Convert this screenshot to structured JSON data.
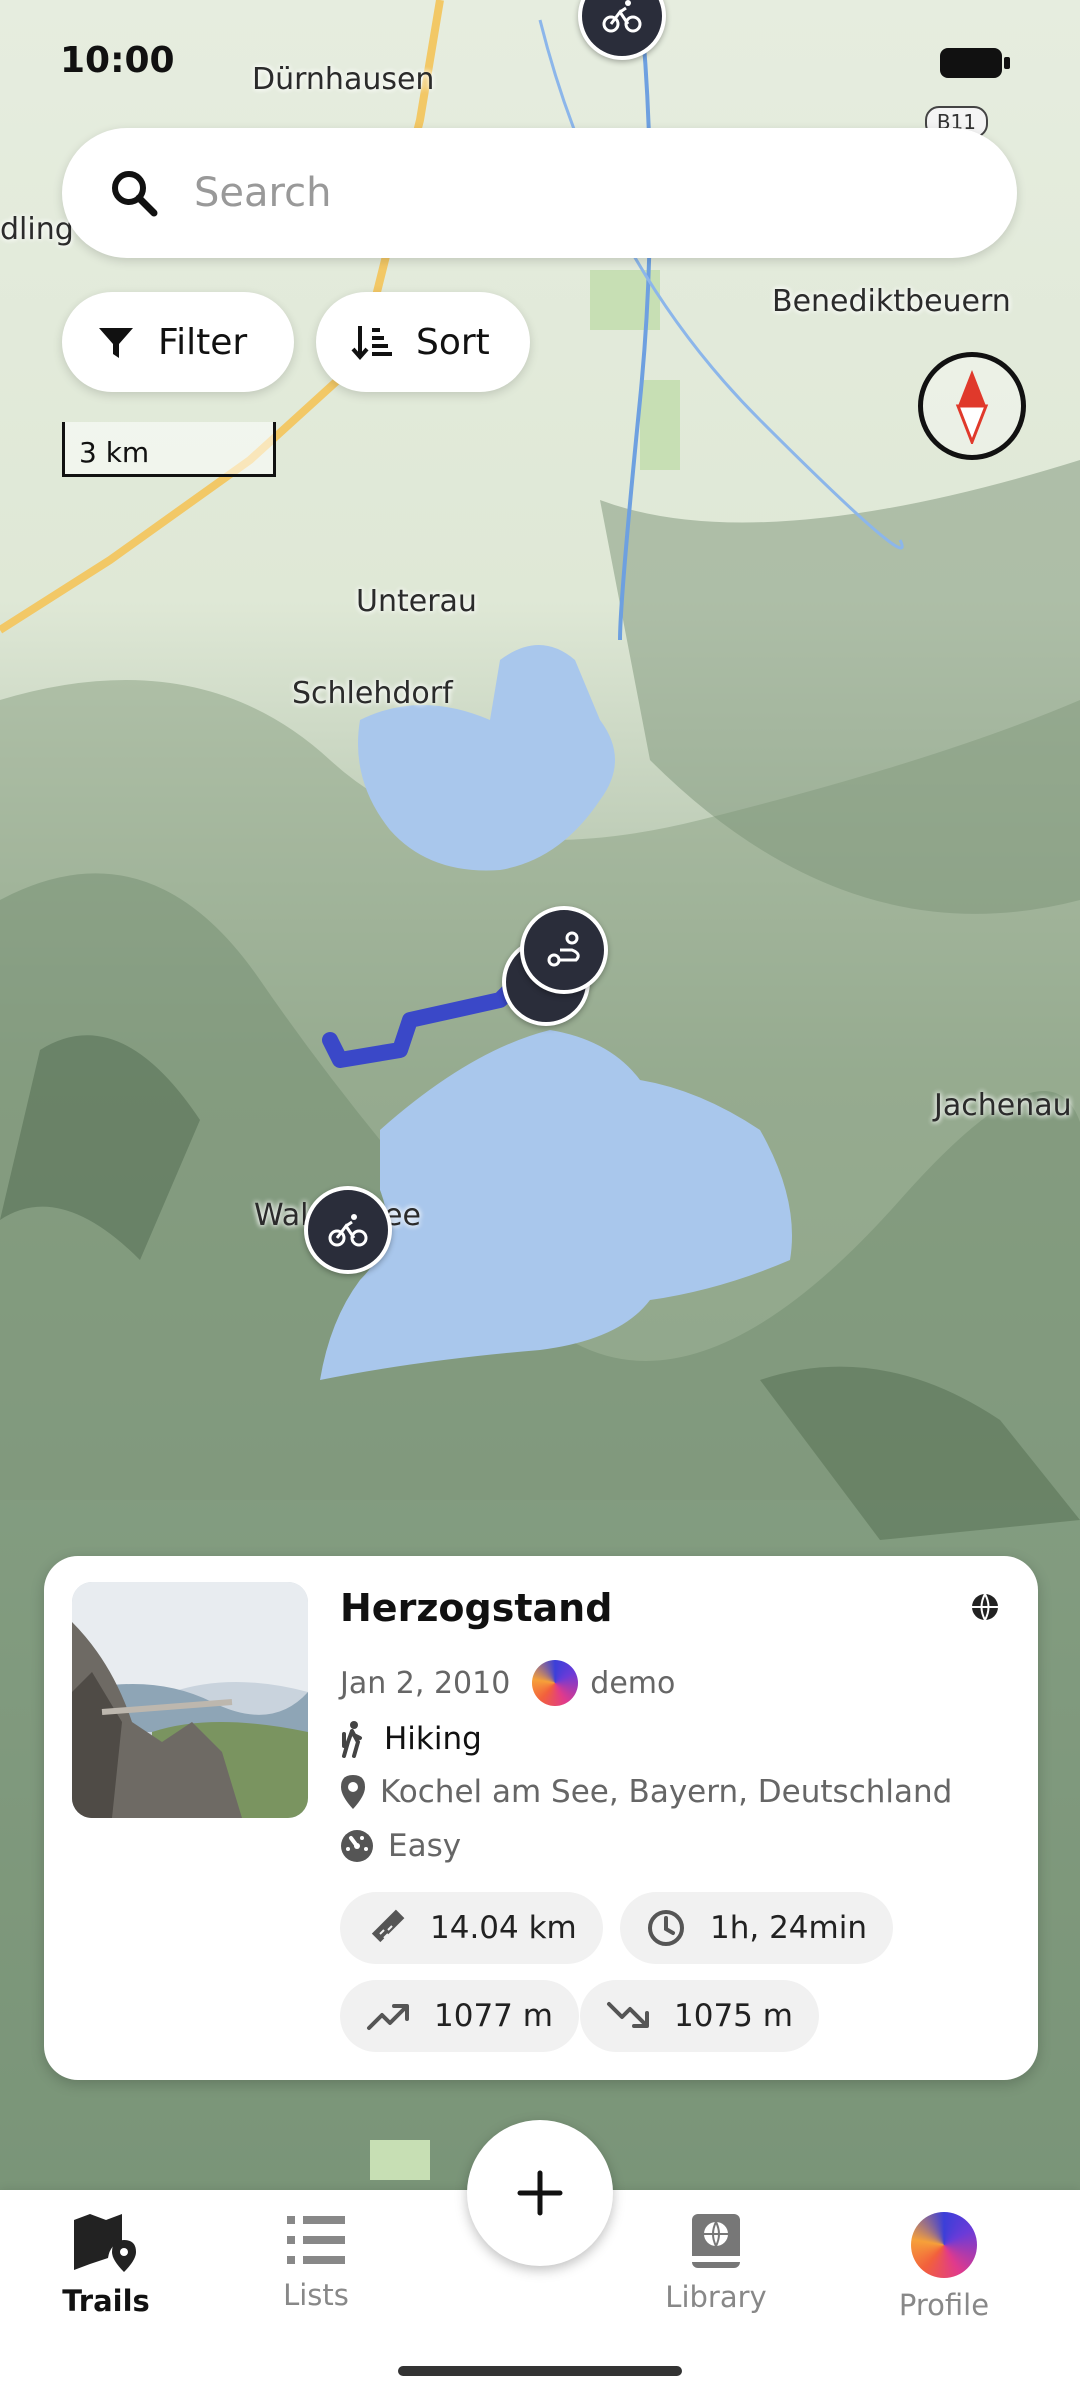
{
  "status_bar": {
    "time": "10:00"
  },
  "map": {
    "route_badge": "B11",
    "place_labels": [
      "Dürnhausen",
      "dling",
      "Benediktbeuern",
      "Unterau",
      "Schlehdorf",
      "Jachenau",
      "Wal",
      "ee"
    ],
    "scale_label": "3 km",
    "accent_route_color": "#3a48c8",
    "water_color": "#a9c7ec"
  },
  "search": {
    "placeholder": "Search",
    "value": ""
  },
  "chips": {
    "filter_label": "Filter",
    "sort_label": "Sort"
  },
  "trail_card": {
    "title": "Herzogstand",
    "date": "Jan 2, 2010",
    "author": "demo",
    "category": "Hiking",
    "location": "Kochel am See, Bayern, Deutschland",
    "difficulty": "Easy",
    "distance": "14.04 km",
    "duration": "1h, 24min",
    "elevation_gain": "1077 m",
    "elevation_loss": "1075 m"
  },
  "bottom_nav": {
    "items": [
      {
        "label": "Trails",
        "icon": "map-pin-icon",
        "active": true
      },
      {
        "label": "Lists",
        "icon": "list-icon",
        "active": false
      },
      {
        "label": "Library",
        "icon": "library-icon",
        "active": false
      },
      {
        "label": "Profile",
        "icon": "avatar-icon",
        "active": false
      }
    ]
  }
}
